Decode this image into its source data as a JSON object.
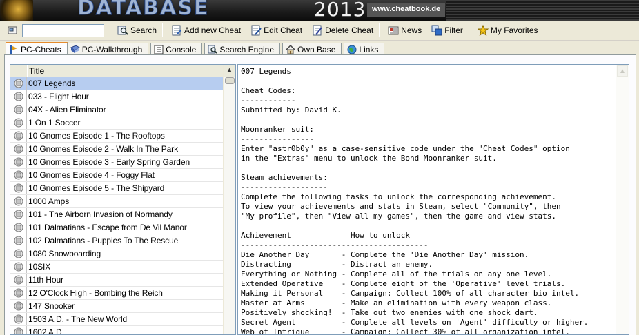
{
  "banner": {
    "logo_word": "DATABASE",
    "year": "2013",
    "url": "www.cheatbook.de"
  },
  "toolbar": {
    "search_value": "",
    "search_label": "Search",
    "add_label": "Add new Cheat",
    "edit_label": "Edit Cheat",
    "delete_label": "Delete Cheat",
    "news_label": "News",
    "filter_label": "Filter",
    "favorites_label": "My Favorites"
  },
  "tabs": [
    {
      "label": "PC-Cheats",
      "active": true
    },
    {
      "label": "PC-Walkthrough"
    },
    {
      "label": "Console"
    },
    {
      "label": "Search Engine"
    },
    {
      "label": "Own Base"
    },
    {
      "label": "Links"
    }
  ],
  "list": {
    "column_title": "Title",
    "selected_index": 0,
    "items": [
      "007 Legends",
      "033 - Flight Hour",
      "04X - Alien Eliminator",
      "1 On 1 Soccer",
      "10 Gnomes Episode 1 - The Rooftops",
      "10 Gnomes Episode 2 - Walk In The Park",
      "10 Gnomes Episode 3 - Early Spring Garden",
      "10 Gnomes Episode 4 - Foggy Flat",
      "10 Gnomes Episode 5 - The Shipyard",
      "1000 Amps",
      "101 - The Airborn Invasion of Normandy",
      "101 Dalmatians - Escape from De Vil Manor",
      "102 Dalmatians - Puppies To The Rescue",
      "1080 Snowboarding",
      "10SIX",
      "11th Hour",
      "12 O'Clock High - Bombing the Reich",
      "147 Snooker",
      "1503 A.D. - The New World",
      "1602 A.D."
    ]
  },
  "content": {
    "text": "007 Legends\n\nCheat Codes:\n------------\nSubmitted by: David K.\n\nMoonranker suit:\n----------------\nEnter \"astr0b0y\" as a case-sensitive code under the \"Cheat Codes\" option\nin the \"Extras\" menu to unlock the Bond Moonranker suit.\n\nSteam achievements:\n-------------------\nComplete the following tasks to unlock the corresponding achievement.\nTo view your achievements and stats in Steam, select \"Community\", then\n\"My profile\", then \"View all my games\", then the game and view stats.\n\nAchievement             How to unlock\n-----------------------------------------\nDie Another Day       - Complete the 'Die Another Day' mission.\nDistracting           - Distract an enemy.\nEverything or Nothing - Complete all of the trials on any one level.\nExtended Operative    - Complete eight of the 'Operative' level trials.\nMaking it Personal    - Campaign: Collect 100% of all character bio intel.\nMaster at Arms        - Make an elimination with every weapon class.\nPositively shocking!  - Take out two enemies with one shock dart.\nSecret Agent          - Complete all levels on 'Agent' difficulty or higher.\nWeb of Intrigue       - Campaign: Collect 30% of all organization intel."
  }
}
